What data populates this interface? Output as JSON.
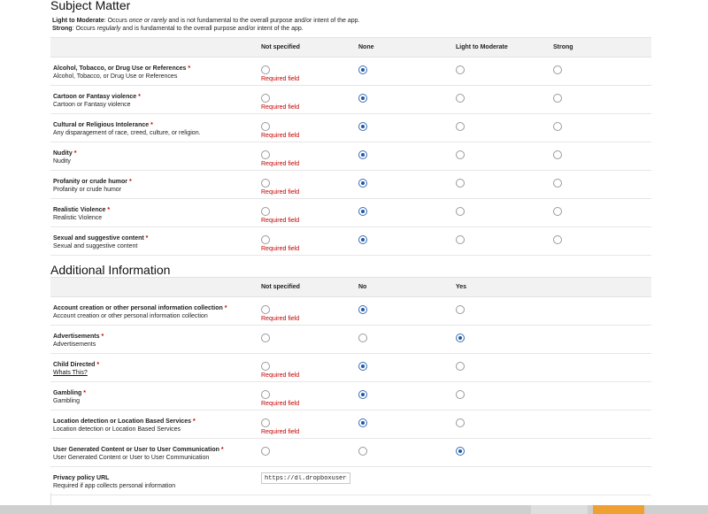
{
  "subject": {
    "title": "Subject Matter",
    "legend": {
      "light_label": "Light to Moderate",
      "light_pre": ": Occurs ",
      "light_em": "once or rarely",
      "light_post": " and is not fundamental to the overall purpose and/or intent of the app.",
      "strong_label": "Strong",
      "strong_pre": ": Occurs ",
      "strong_em": "regularly",
      "strong_post": " and is fundamental to the overall purpose and/or intent of the app."
    },
    "columns": [
      "Not specified",
      "None",
      "Light to Moderate",
      "Strong"
    ],
    "rows": [
      {
        "title": "Alcohol, Tobacco, or Drug Use or References",
        "desc": "Alcohol, Tobacco, or Drug Use or References",
        "selected": 1,
        "error": "Required field"
      },
      {
        "title": "Cartoon or Fantasy violence",
        "desc": "Cartoon or Fantasy violence",
        "selected": 1,
        "error": "Required field"
      },
      {
        "title": "Cultural or Religious Intolerance",
        "desc": "Any disparagement of race, creed, culture, or religion.",
        "selected": 1,
        "error": "Required field"
      },
      {
        "title": "Nudity",
        "desc": "Nudity",
        "selected": 1,
        "error": "Required field"
      },
      {
        "title": "Profanity or crude humor",
        "desc": "Profanity or crude humor",
        "selected": 1,
        "error": "Required field"
      },
      {
        "title": "Realistic Violence",
        "desc": "Realistic Violence",
        "selected": 1,
        "error": "Required field"
      },
      {
        "title": "Sexual and suggestive content",
        "desc": "Sexual and suggestive content",
        "selected": 1,
        "error": "Required field"
      }
    ]
  },
  "additional": {
    "title": "Additional Information",
    "columns": [
      "Not specified",
      "No",
      "Yes"
    ],
    "rows": [
      {
        "title": "Account creation or other personal information collection",
        "desc": "Account creation or other personal information collection",
        "selected": 1,
        "error": "Required field"
      },
      {
        "title": "Advertisements",
        "desc": "Advertisements",
        "selected": 2,
        "error": ""
      },
      {
        "title": "Child Directed",
        "desc": "Whats This?",
        "desc_link": true,
        "selected": 1,
        "error": "Required field"
      },
      {
        "title": "Gambling",
        "desc": "Gambling",
        "selected": 1,
        "error": "Required field"
      },
      {
        "title": "Location detection or Location Based Services",
        "desc": "Location detection or Location Based Services",
        "selected": 1,
        "error": "Required field"
      },
      {
        "title": "User Generated Content or User to User Communication",
        "desc": "User Generated Content or User to User Communication",
        "selected": 2,
        "error": ""
      }
    ],
    "privacy": {
      "title": "Privacy policy URL",
      "desc": "Required if app collects personal information",
      "value": "https://dl.dropboxusercontent.com/"
    }
  },
  "required_marker": "*",
  "colors": {
    "error": "#c40000",
    "radio_checked": "#1f58a8",
    "header_bg": "#f2f2f2",
    "footer_accent": "#f0a030"
  }
}
